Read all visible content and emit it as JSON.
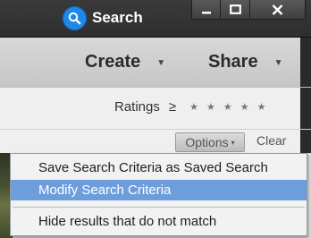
{
  "titlebar": {
    "search_label": "Search",
    "icons": {
      "search": "search-icon",
      "minimize": "minimize-icon",
      "maximize": "maximize-icon",
      "close": "close-icon"
    }
  },
  "actions": {
    "create_label": "Create",
    "share_label": "Share",
    "caret": "▼"
  },
  "filters": {
    "ratings_label": "Ratings",
    "comparator": "≥",
    "stars": [
      "★",
      "★",
      "★",
      "★",
      "★"
    ],
    "options_label": "Options",
    "options_caret": "▾",
    "clear_label": "Clear"
  },
  "menu": {
    "items": [
      {
        "label": "Save Search Criteria as Saved Search",
        "highlighted": false
      },
      {
        "label": "Modify Search Criteria",
        "highlighted": true
      },
      {
        "label": "Hide results that do not match",
        "highlighted": false
      }
    ],
    "highlight_color": "#6d9edb"
  },
  "colors": {
    "accent_blue": "#1e88e5",
    "titlebar": "#333333",
    "actionbar": "#cfcfcf"
  }
}
